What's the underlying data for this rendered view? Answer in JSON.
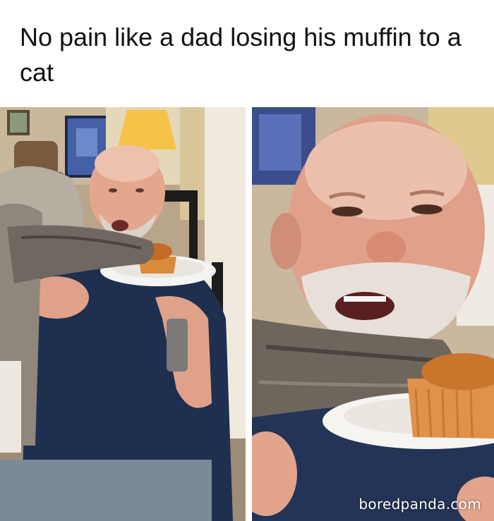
{
  "meme": {
    "caption": "No pain like a dad losing his muffin to a cat",
    "watermark": "boredpanda.com"
  },
  "panels": [
    {
      "icon": "photo-dad-cat-wide"
    },
    {
      "icon": "photo-dad-cat-closeup"
    }
  ]
}
